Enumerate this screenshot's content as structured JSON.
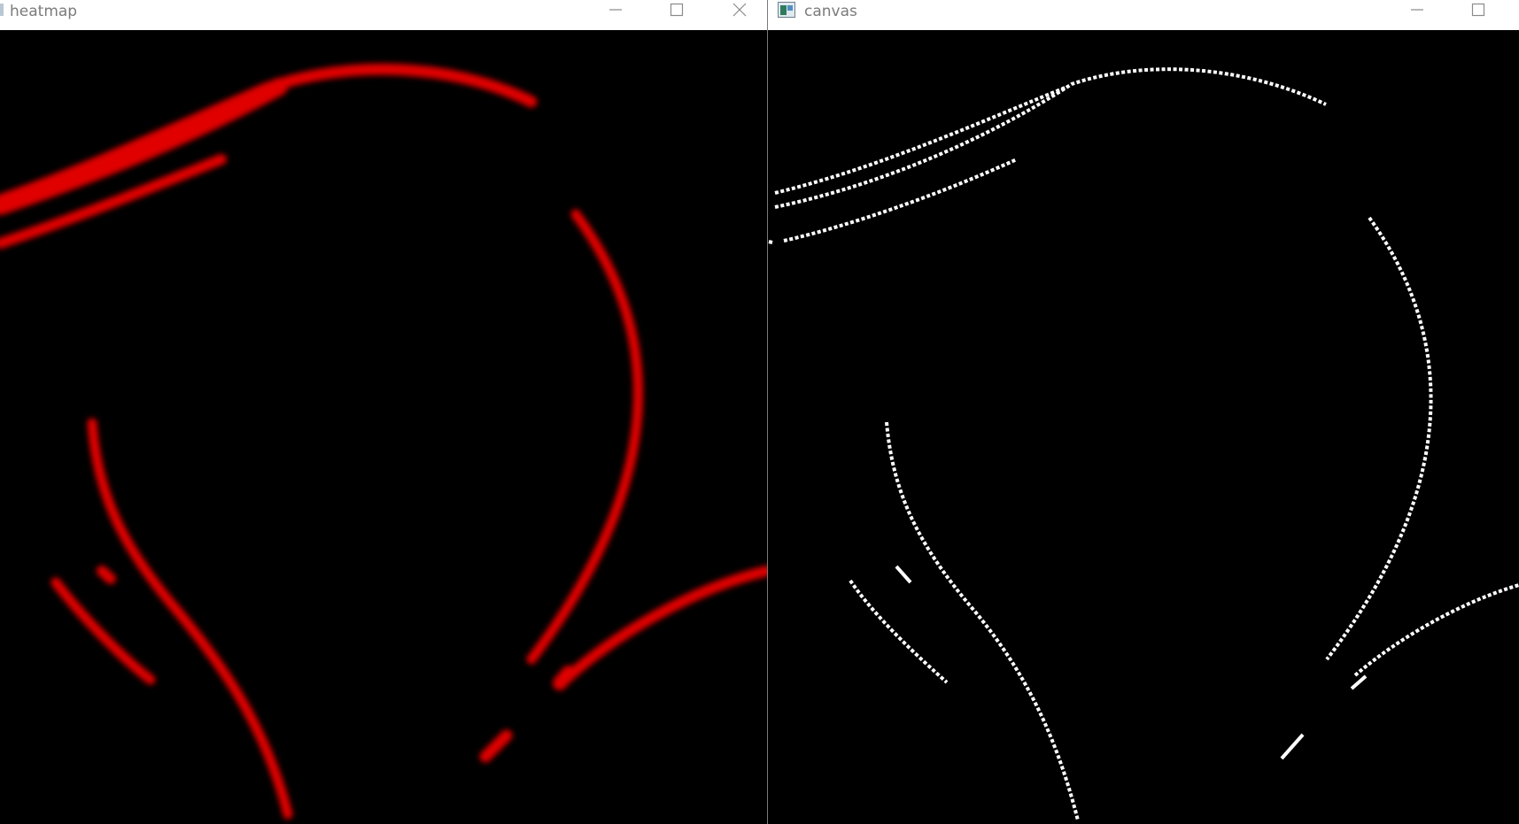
{
  "windows": [
    {
      "id": "heatmap",
      "title": "heatmap",
      "controls": [
        "minimize-icon",
        "maximize-icon",
        "close-icon"
      ],
      "stroke_color": "#e00000",
      "background": "#000000"
    },
    {
      "id": "canvas",
      "title": "canvas",
      "controls": [
        "minimize-icon",
        "maximize-icon"
      ],
      "stroke_color": "#ffffff",
      "background": "#000000"
    }
  ]
}
